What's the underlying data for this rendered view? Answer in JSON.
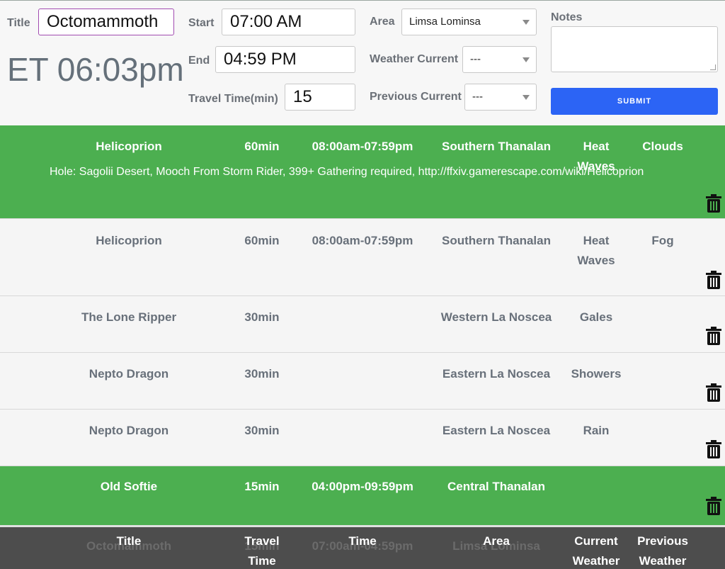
{
  "form": {
    "title_label": "Title",
    "title_value": "Octomammoth",
    "clock": "ET 06:03pm",
    "start_label": "Start",
    "start_value": "07:00 AM",
    "end_label": "End",
    "end_value": "04:59 PM",
    "travel_label": "Travel Time(min)",
    "travel_value": "15",
    "area_label": "Area",
    "area_value": "Limsa Lominsa",
    "weather_label": "Weather Current",
    "weather_value": "---",
    "previous_label": "Previous Current",
    "previous_value": "---",
    "notes_label": "Notes",
    "notes_value": "",
    "submit_label": "SUBMIT"
  },
  "rows": [
    {
      "title": "Helicoprion",
      "travel": "60min",
      "time": "08:00am-07:59pm",
      "area": "Southern Thanalan",
      "current": "Heat Waves",
      "previous": "Clouds",
      "note": "Hole: Sagolii Desert, Mooch From Storm Rider, 399+ Gathering required, http://ffxiv.gamerescape.com/wiki/Helicoprion",
      "state": "active"
    },
    {
      "title": "Helicoprion",
      "travel": "60min",
      "time": "08:00am-07:59pm",
      "area": "Southern Thanalan",
      "current": "Heat Waves",
      "previous": "Fog",
      "note": "",
      "state": "inactive"
    },
    {
      "title": "The Lone Ripper",
      "travel": "30min",
      "time": "",
      "area": "Western La Noscea",
      "current": "Gales",
      "previous": "",
      "note": "",
      "state": "inactive"
    },
    {
      "title": "Nepto Dragon",
      "travel": "30min",
      "time": "",
      "area": "Eastern La Noscea",
      "current": "Showers",
      "previous": "",
      "note": "",
      "state": "inactive"
    },
    {
      "title": "Nepto Dragon",
      "travel": "30min",
      "time": "",
      "area": "Eastern La Noscea",
      "current": "Rain",
      "previous": "",
      "note": "",
      "state": "inactive"
    },
    {
      "title": "Old Softie",
      "travel": "15min",
      "time": "04:00pm-09:59pm",
      "area": "Central Thanalan",
      "current": "",
      "previous": "",
      "note": "",
      "state": "active"
    }
  ],
  "ghost_row": {
    "title": "Octomammoth",
    "travel": "15min",
    "time": "07:00am-04:59pm",
    "area": "Limsa Lominsa"
  },
  "footer": {
    "title": "Title",
    "travel": "Travel Time",
    "time": "Time",
    "area": "Area",
    "current": "Current Weather",
    "previous": "Previous Weather"
  },
  "icons": {
    "delete": "trash-icon",
    "dropdown": "chevron-down-icon"
  },
  "colors": {
    "active_row": "#4caf50",
    "submit": "#2c64f5",
    "footer": "#4d4d4d",
    "focus_border": "#a14bb0"
  }
}
